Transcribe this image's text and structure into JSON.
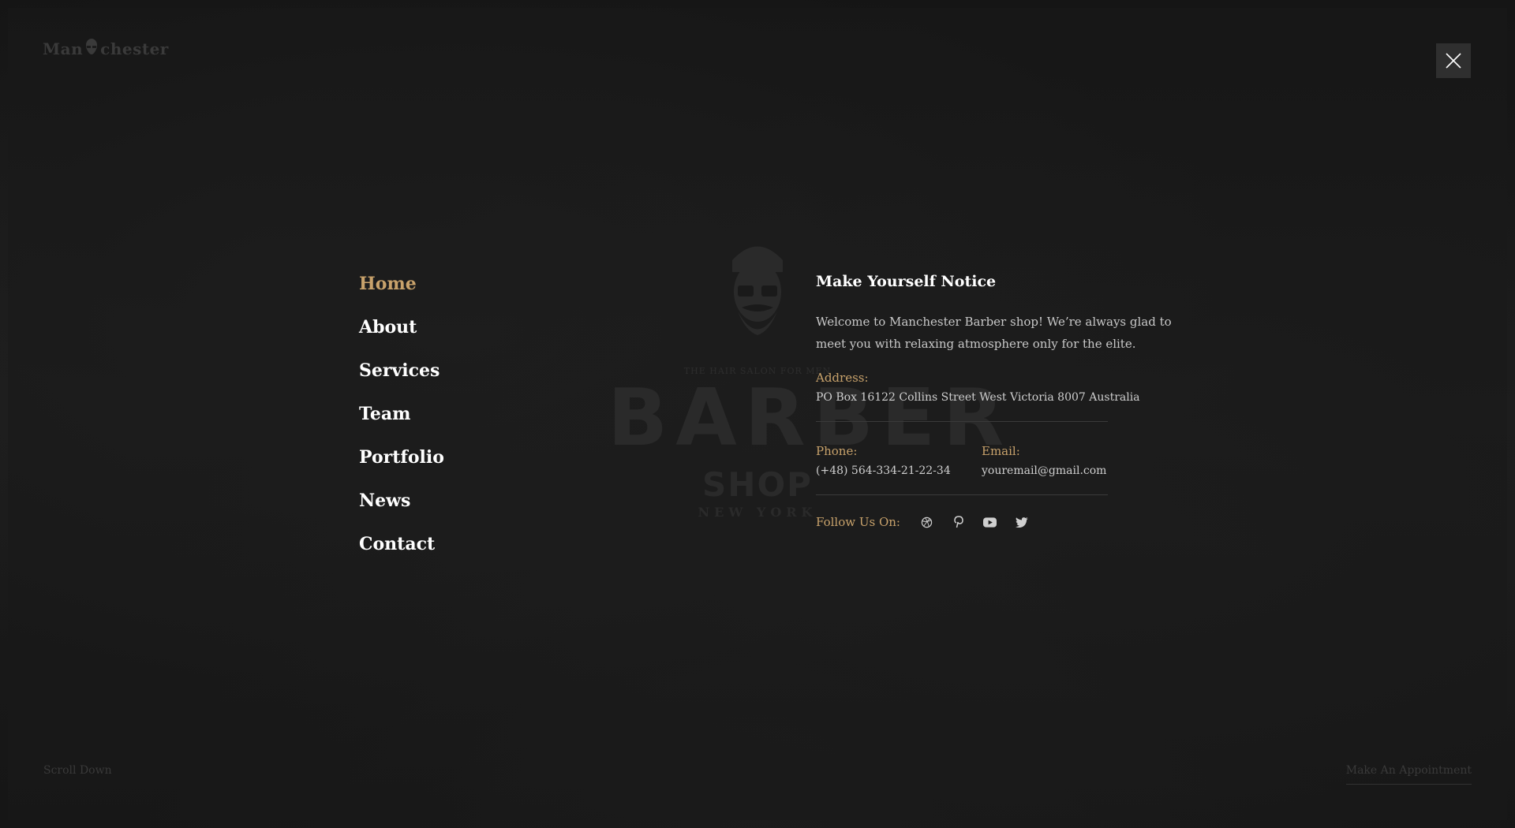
{
  "header": {
    "logo_left": "Man",
    "logo_right": "chester",
    "logo_icon": "bearded-head-icon",
    "close_icon": "close-icon"
  },
  "emblem": {
    "tagline": "THE HAIR SALON FOR MEN",
    "title": "BARBER",
    "subtitle": "SHOP",
    "banner": "NEW YORK"
  },
  "menu": {
    "items": [
      {
        "label": "Home",
        "active": true
      },
      {
        "label": "About",
        "active": false
      },
      {
        "label": "Services",
        "active": false
      },
      {
        "label": "Team",
        "active": false
      },
      {
        "label": "Portfolio",
        "active": false
      },
      {
        "label": "News",
        "active": false
      },
      {
        "label": "Contact",
        "active": false
      }
    ]
  },
  "info": {
    "title": "Make Yourself Notice",
    "description": "Welcome to Manchester  Barber shop! We’re always glad to meet you with relaxing atmosphere only for the elite.",
    "address_label": "Address:",
    "address_value": "PO Box 16122 Collins Street West Victoria 8007 Australia",
    "phone_label": "Phone:",
    "phone_value": "(+48) 564-334-21-22-34",
    "email_label": "Email:",
    "email_value": "youremail@gmail.com",
    "follow_label": "Follow Us On:",
    "social_icons": [
      "dribbble-icon",
      "pinterest-icon",
      "youtube-icon",
      "twitter-icon"
    ]
  },
  "footer": {
    "scroll_down": "Scroll Down",
    "appointment": "Make An Appointment"
  },
  "colors": {
    "accent": "#c8a26b",
    "background": "#161616",
    "text": "#ffffff"
  }
}
